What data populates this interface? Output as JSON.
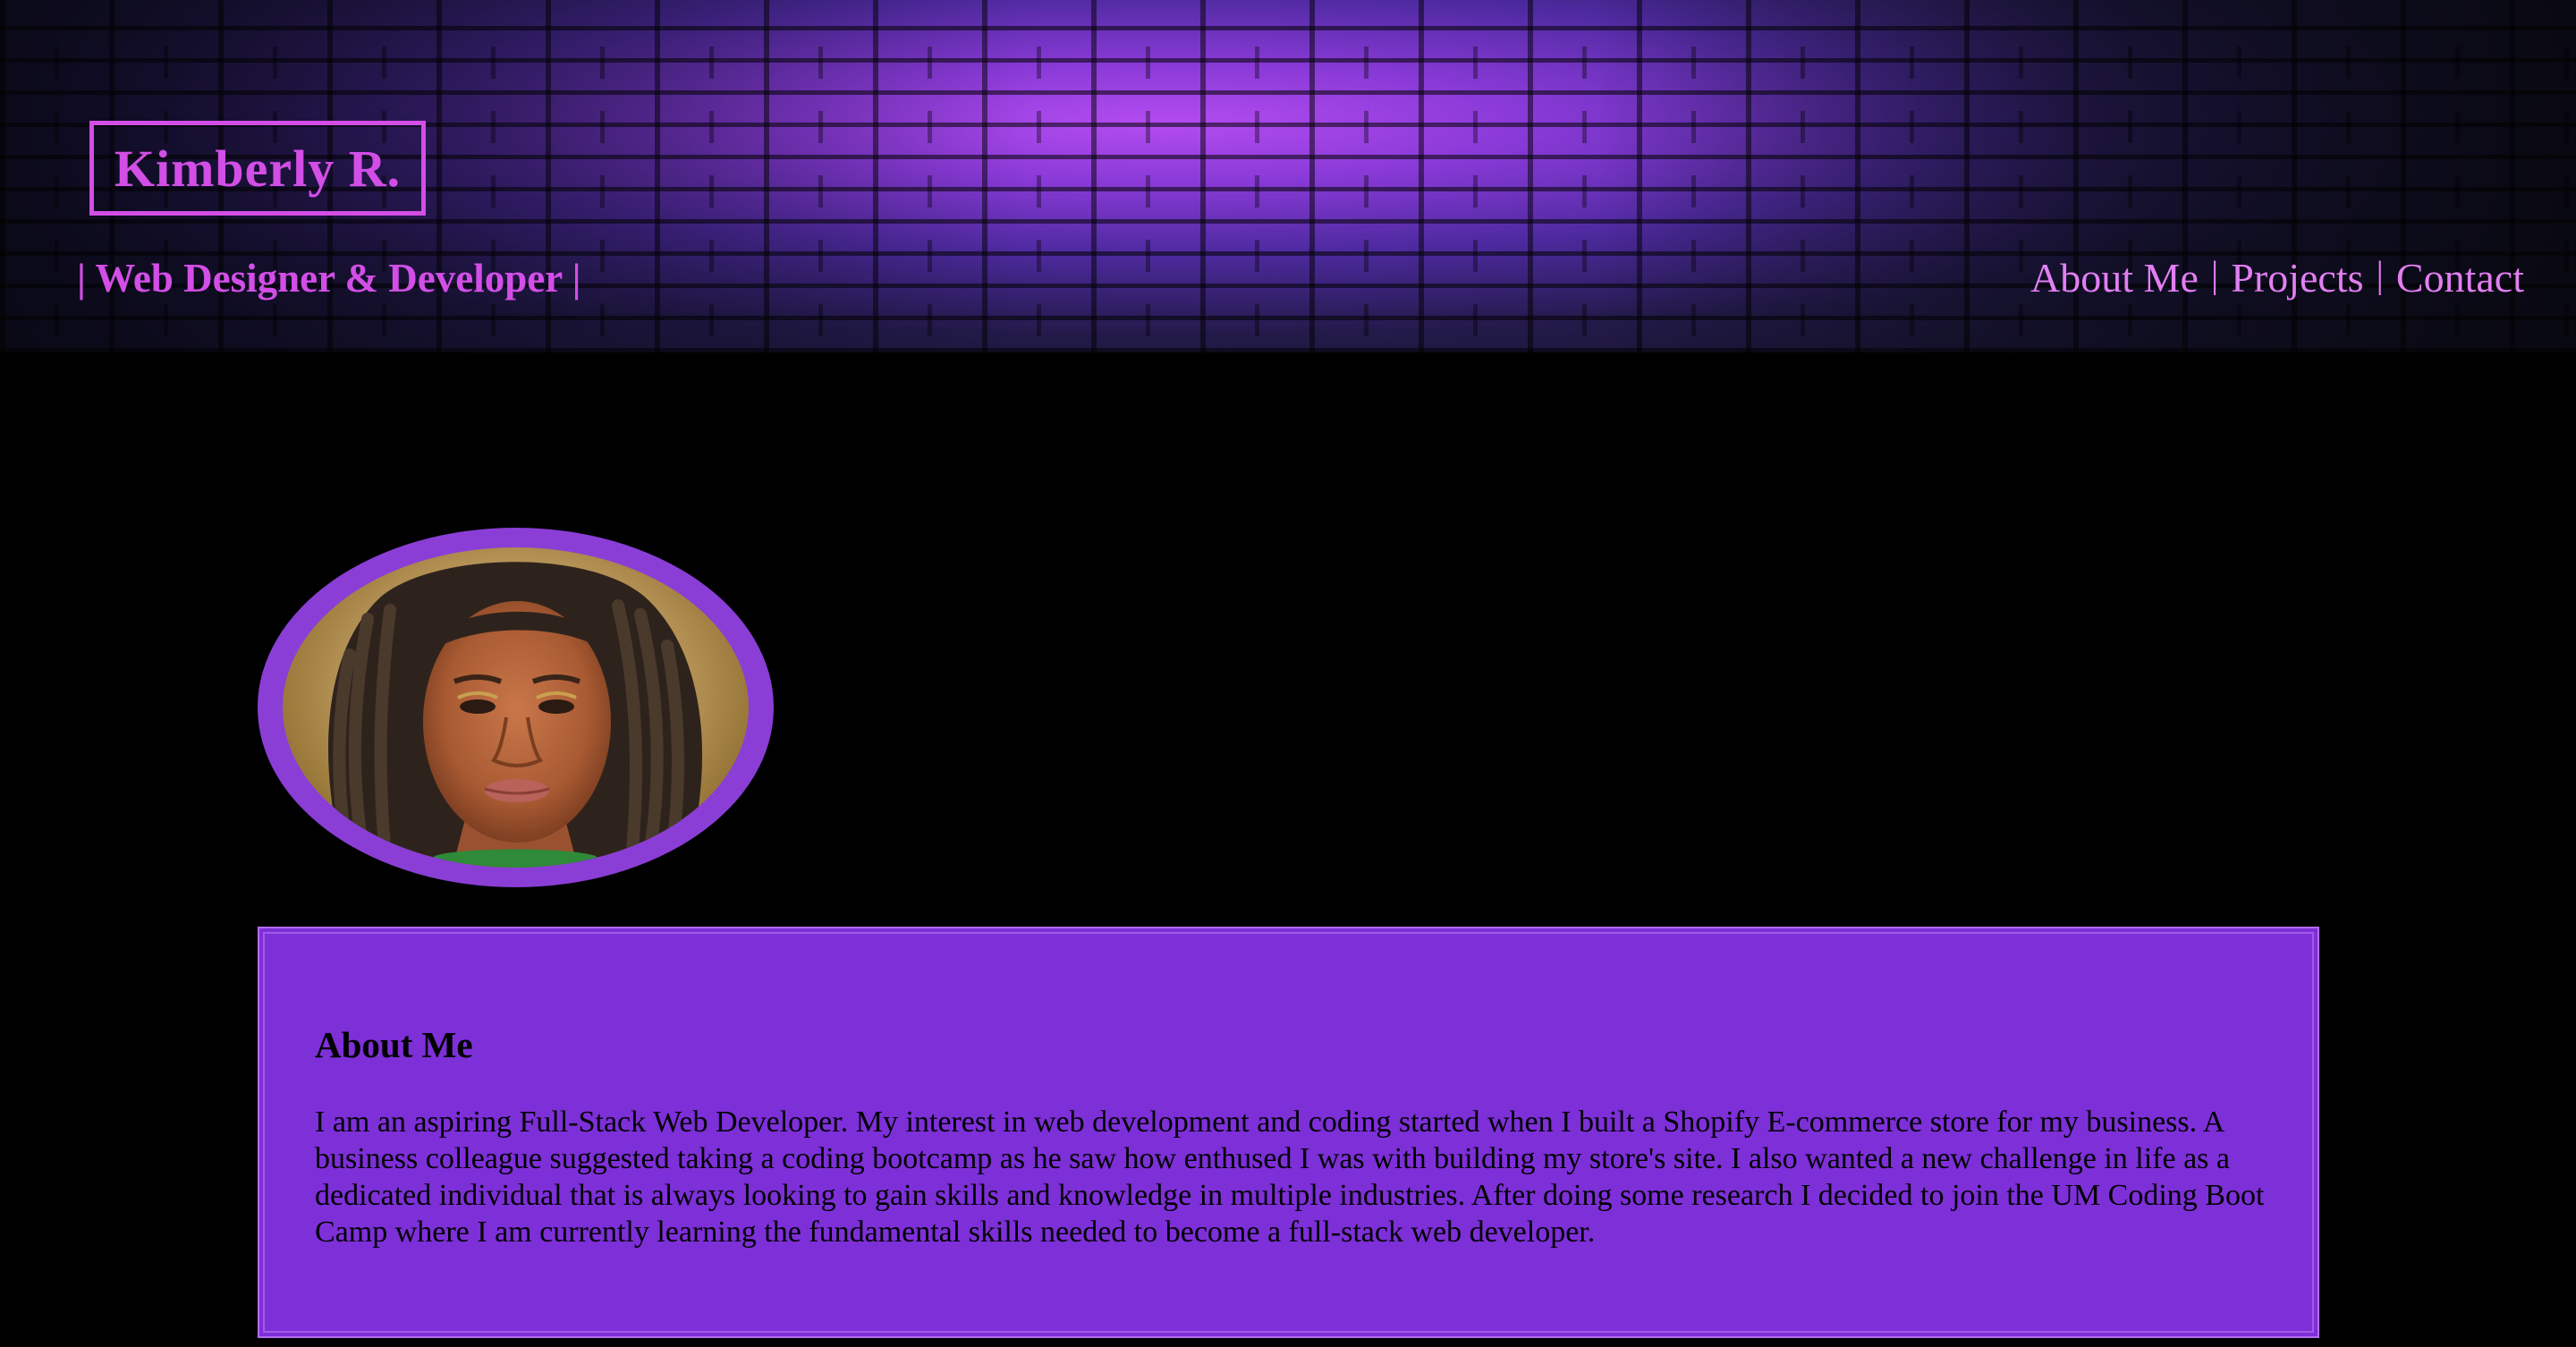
{
  "header": {
    "logo": "Kimberly R.",
    "tagline": "| Web Designer & Developer |",
    "nav": {
      "about": "About Me",
      "projects": "Projects",
      "contact": "Contact",
      "separator": "|"
    }
  },
  "profile": {
    "photo_alt": "Profile photo of Kimberly R."
  },
  "about": {
    "heading": "About Me",
    "body": "I am an aspiring Full-Stack Web Developer. My interest in web development and coding started when I built a Shopify E-commerce store for my business. A business colleague suggested taking a coding bootcamp as he saw how enthused I was with building my store's site. I also wanted a new challenge in life as a dedicated individual that is always looking to gain skills and knowledge in multiple industries. After doing some research I decided to join the UM Coding Boot Camp where I am currently learning the fundamental skills needed to become a full-stack web developer."
  },
  "colors": {
    "accent": "#d24ee6",
    "nav_text": "#e27ef2",
    "card_bg": "#7d2fd8",
    "avatar_ring": "#8a3ed6",
    "page_bg": "#000000"
  }
}
